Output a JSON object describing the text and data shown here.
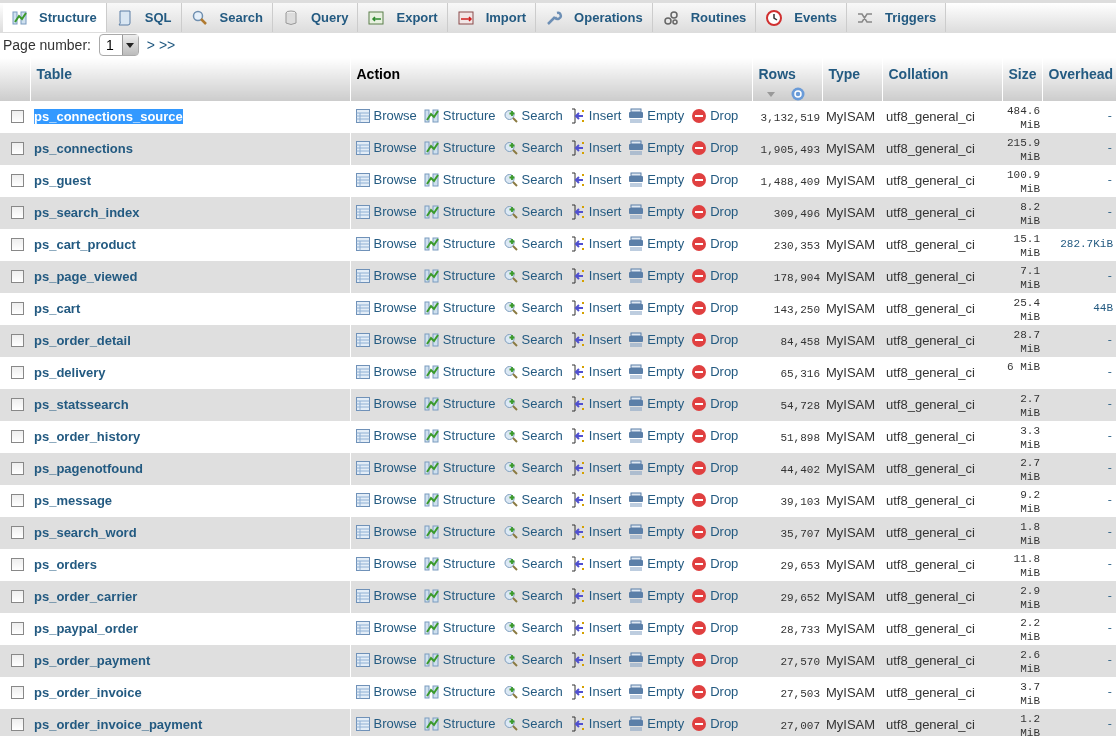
{
  "tabs": [
    {
      "label": "Structure",
      "selected": true
    },
    {
      "label": "SQL",
      "selected": false
    },
    {
      "label": "Search",
      "selected": false
    },
    {
      "label": "Query",
      "selected": false
    },
    {
      "label": "Export",
      "selected": false
    },
    {
      "label": "Import",
      "selected": false
    },
    {
      "label": "Operations",
      "selected": false
    },
    {
      "label": "Routines",
      "selected": false
    },
    {
      "label": "Events",
      "selected": false
    },
    {
      "label": "Triggers",
      "selected": false
    }
  ],
  "pager": {
    "label": "Page number:",
    "value": "1",
    "next": ">",
    "last": ">>"
  },
  "table": {
    "columns": [
      "Table",
      "Action",
      "Rows",
      "Type",
      "Collation",
      "Size",
      "Overhead"
    ],
    "rows": [
      {
        "name": "ps_connections_source",
        "selected": true,
        "checked": false,
        "actions": [
          "Browse",
          "Structure",
          "Search",
          "Insert",
          "Empty",
          "Drop"
        ],
        "rows": "3,132,519",
        "type": "MyISAM",
        "collation": "utf8_general_ci",
        "size": "484.6 MiB",
        "overhead": "-"
      },
      {
        "name": "ps_connections",
        "selected": false,
        "checked": false,
        "actions": [
          "Browse",
          "Structure",
          "Search",
          "Insert",
          "Empty",
          "Drop"
        ],
        "rows": "1,905,493",
        "type": "MyISAM",
        "collation": "utf8_general_ci",
        "size": "215.9 MiB",
        "overhead": "-"
      },
      {
        "name": "ps_guest",
        "selected": false,
        "checked": false,
        "actions": [
          "Browse",
          "Structure",
          "Search",
          "Insert",
          "Empty",
          "Drop"
        ],
        "rows": "1,488,409",
        "type": "MyISAM",
        "collation": "utf8_general_ci",
        "size": "100.9 MiB",
        "overhead": "-"
      },
      {
        "name": "ps_search_index",
        "selected": false,
        "checked": false,
        "actions": [
          "Browse",
          "Structure",
          "Search",
          "Insert",
          "Empty",
          "Drop"
        ],
        "rows": "309,496",
        "type": "MyISAM",
        "collation": "utf8_general_ci",
        "size": "8.2 MiB",
        "overhead": "-"
      },
      {
        "name": "ps_cart_product",
        "selected": false,
        "checked": false,
        "actions": [
          "Browse",
          "Structure",
          "Search",
          "Insert",
          "Empty",
          "Drop"
        ],
        "rows": "230,353",
        "type": "MyISAM",
        "collation": "utf8_general_ci",
        "size": "15.1 MiB",
        "overhead": "282.7KiB"
      },
      {
        "name": "ps_page_viewed",
        "selected": false,
        "checked": false,
        "actions": [
          "Browse",
          "Structure",
          "Search",
          "Insert",
          "Empty",
          "Drop"
        ],
        "rows": "178,904",
        "type": "MyISAM",
        "collation": "utf8_general_ci",
        "size": "7.1 MiB",
        "overhead": "-"
      },
      {
        "name": "ps_cart",
        "selected": false,
        "checked": false,
        "actions": [
          "Browse",
          "Structure",
          "Search",
          "Insert",
          "Empty",
          "Drop"
        ],
        "rows": "143,250",
        "type": "MyISAM",
        "collation": "utf8_general_ci",
        "size": "25.4 MiB",
        "overhead": "44B"
      },
      {
        "name": "ps_order_detail",
        "selected": false,
        "checked": false,
        "actions": [
          "Browse",
          "Structure",
          "Search",
          "Insert",
          "Empty",
          "Drop"
        ],
        "rows": "84,458",
        "type": "MyISAM",
        "collation": "utf8_general_ci",
        "size": "28.7 MiB",
        "overhead": "-"
      },
      {
        "name": "ps_delivery",
        "selected": false,
        "checked": false,
        "actions": [
          "Browse",
          "Structure",
          "Search",
          "Insert",
          "Empty",
          "Drop"
        ],
        "rows": "65,316",
        "type": "MyISAM",
        "collation": "utf8_general_ci",
        "size": "6 MiB",
        "overhead": "-"
      },
      {
        "name": "ps_statssearch",
        "selected": false,
        "checked": false,
        "actions": [
          "Browse",
          "Structure",
          "Search",
          "Insert",
          "Empty",
          "Drop"
        ],
        "rows": "54,728",
        "type": "MyISAM",
        "collation": "utf8_general_ci",
        "size": "2.7 MiB",
        "overhead": "-"
      },
      {
        "name": "ps_order_history",
        "selected": false,
        "checked": false,
        "actions": [
          "Browse",
          "Structure",
          "Search",
          "Insert",
          "Empty",
          "Drop"
        ],
        "rows": "51,898",
        "type": "MyISAM",
        "collation": "utf8_general_ci",
        "size": "3.3 MiB",
        "overhead": "-"
      },
      {
        "name": "ps_pagenotfound",
        "selected": false,
        "checked": false,
        "actions": [
          "Browse",
          "Structure",
          "Search",
          "Insert",
          "Empty",
          "Drop"
        ],
        "rows": "44,402",
        "type": "MyISAM",
        "collation": "utf8_general_ci",
        "size": "2.7 MiB",
        "overhead": "-"
      },
      {
        "name": "ps_message",
        "selected": false,
        "checked": false,
        "actions": [
          "Browse",
          "Structure",
          "Search",
          "Insert",
          "Empty",
          "Drop"
        ],
        "rows": "39,103",
        "type": "MyISAM",
        "collation": "utf8_general_ci",
        "size": "9.2 MiB",
        "overhead": "-"
      },
      {
        "name": "ps_search_word",
        "selected": false,
        "checked": false,
        "actions": [
          "Browse",
          "Structure",
          "Search",
          "Insert",
          "Empty",
          "Drop"
        ],
        "rows": "35,707",
        "type": "MyISAM",
        "collation": "utf8_general_ci",
        "size": "1.8 MiB",
        "overhead": "-"
      },
      {
        "name": "ps_orders",
        "selected": false,
        "checked": false,
        "actions": [
          "Browse",
          "Structure",
          "Search",
          "Insert",
          "Empty",
          "Drop"
        ],
        "rows": "29,653",
        "type": "MyISAM",
        "collation": "utf8_general_ci",
        "size": "11.8 MiB",
        "overhead": "-"
      },
      {
        "name": "ps_order_carrier",
        "selected": false,
        "checked": false,
        "actions": [
          "Browse",
          "Structure",
          "Search",
          "Insert",
          "Empty",
          "Drop"
        ],
        "rows": "29,652",
        "type": "MyISAM",
        "collation": "utf8_general_ci",
        "size": "2.9 MiB",
        "overhead": "-"
      },
      {
        "name": "ps_paypal_order",
        "selected": false,
        "checked": false,
        "actions": [
          "Browse",
          "Structure",
          "Search",
          "Insert",
          "Empty",
          "Drop"
        ],
        "rows": "28,733",
        "type": "MyISAM",
        "collation": "utf8_general_ci",
        "size": "2.2 MiB",
        "overhead": "-"
      },
      {
        "name": "ps_order_payment",
        "selected": false,
        "checked": false,
        "actions": [
          "Browse",
          "Structure",
          "Search",
          "Insert",
          "Empty",
          "Drop"
        ],
        "rows": "27,570",
        "type": "MyISAM",
        "collation": "utf8_general_ci",
        "size": "2.6 MiB",
        "overhead": "-"
      },
      {
        "name": "ps_order_invoice",
        "selected": false,
        "checked": false,
        "actions": [
          "Browse",
          "Structure",
          "Search",
          "Insert",
          "Empty",
          "Drop"
        ],
        "rows": "27,503",
        "type": "MyISAM",
        "collation": "utf8_general_ci",
        "size": "3.7 MiB",
        "overhead": "-"
      },
      {
        "name": "ps_order_invoice_payment",
        "selected": false,
        "checked": false,
        "actions": [
          "Browse",
          "Structure",
          "Search",
          "Insert",
          "Empty",
          "Drop"
        ],
        "rows": "27,007",
        "type": "MyISAM",
        "collation": "utf8_general_ci",
        "size": "1.2 MiB",
        "overhead": "-"
      }
    ]
  }
}
